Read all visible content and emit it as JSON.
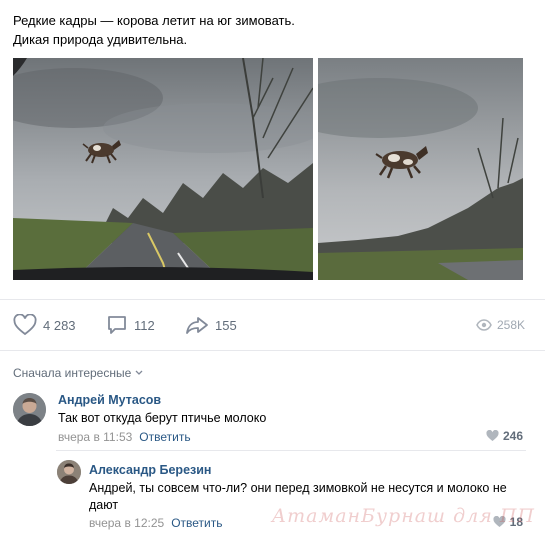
{
  "post": {
    "text_line1": "Редкие кадры — корова летит на юг зимовать.",
    "text_line2": "Дикая природа удивительна."
  },
  "actions": {
    "likes": "4 283",
    "comments": "112",
    "shares": "155",
    "views": "258K"
  },
  "comments_section": {
    "sort_label": "Сначала интересные"
  },
  "comments": [
    {
      "author": "Андрей Мутасов",
      "text": "Так вот откуда берут птичье молоко",
      "time": "вчера в 11:53",
      "reply_label": "Ответить",
      "likes": "246"
    },
    {
      "author": "Александр Березин",
      "text": "Андрей, ты совсем что-ли? они перед зимовкой не несутся и молоко не дают",
      "time": "вчера в 12:25",
      "reply_label": "Ответить",
      "likes": "18"
    }
  ],
  "watermark": "АтаманБурнаш для ПП",
  "colors": {
    "link": "#2a5885",
    "muted": "#626d7a",
    "divider": "#e7e8ec"
  }
}
